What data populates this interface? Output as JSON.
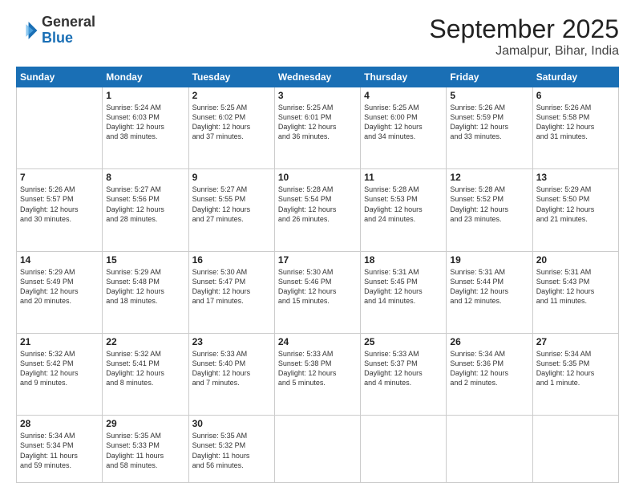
{
  "header": {
    "logo_general": "General",
    "logo_blue": "Blue",
    "month_title": "September 2025",
    "subtitle": "Jamalpur, Bihar, India"
  },
  "weekdays": [
    "Sunday",
    "Monday",
    "Tuesday",
    "Wednesday",
    "Thursday",
    "Friday",
    "Saturday"
  ],
  "weeks": [
    [
      {
        "day": "",
        "lines": []
      },
      {
        "day": "1",
        "lines": [
          "Sunrise: 5:24 AM",
          "Sunset: 6:03 PM",
          "Daylight: 12 hours",
          "and 38 minutes."
        ]
      },
      {
        "day": "2",
        "lines": [
          "Sunrise: 5:25 AM",
          "Sunset: 6:02 PM",
          "Daylight: 12 hours",
          "and 37 minutes."
        ]
      },
      {
        "day": "3",
        "lines": [
          "Sunrise: 5:25 AM",
          "Sunset: 6:01 PM",
          "Daylight: 12 hours",
          "and 36 minutes."
        ]
      },
      {
        "day": "4",
        "lines": [
          "Sunrise: 5:25 AM",
          "Sunset: 6:00 PM",
          "Daylight: 12 hours",
          "and 34 minutes."
        ]
      },
      {
        "day": "5",
        "lines": [
          "Sunrise: 5:26 AM",
          "Sunset: 5:59 PM",
          "Daylight: 12 hours",
          "and 33 minutes."
        ]
      },
      {
        "day": "6",
        "lines": [
          "Sunrise: 5:26 AM",
          "Sunset: 5:58 PM",
          "Daylight: 12 hours",
          "and 31 minutes."
        ]
      }
    ],
    [
      {
        "day": "7",
        "lines": [
          "Sunrise: 5:26 AM",
          "Sunset: 5:57 PM",
          "Daylight: 12 hours",
          "and 30 minutes."
        ]
      },
      {
        "day": "8",
        "lines": [
          "Sunrise: 5:27 AM",
          "Sunset: 5:56 PM",
          "Daylight: 12 hours",
          "and 28 minutes."
        ]
      },
      {
        "day": "9",
        "lines": [
          "Sunrise: 5:27 AM",
          "Sunset: 5:55 PM",
          "Daylight: 12 hours",
          "and 27 minutes."
        ]
      },
      {
        "day": "10",
        "lines": [
          "Sunrise: 5:28 AM",
          "Sunset: 5:54 PM",
          "Daylight: 12 hours",
          "and 26 minutes."
        ]
      },
      {
        "day": "11",
        "lines": [
          "Sunrise: 5:28 AM",
          "Sunset: 5:53 PM",
          "Daylight: 12 hours",
          "and 24 minutes."
        ]
      },
      {
        "day": "12",
        "lines": [
          "Sunrise: 5:28 AM",
          "Sunset: 5:52 PM",
          "Daylight: 12 hours",
          "and 23 minutes."
        ]
      },
      {
        "day": "13",
        "lines": [
          "Sunrise: 5:29 AM",
          "Sunset: 5:50 PM",
          "Daylight: 12 hours",
          "and 21 minutes."
        ]
      }
    ],
    [
      {
        "day": "14",
        "lines": [
          "Sunrise: 5:29 AM",
          "Sunset: 5:49 PM",
          "Daylight: 12 hours",
          "and 20 minutes."
        ]
      },
      {
        "day": "15",
        "lines": [
          "Sunrise: 5:29 AM",
          "Sunset: 5:48 PM",
          "Daylight: 12 hours",
          "and 18 minutes."
        ]
      },
      {
        "day": "16",
        "lines": [
          "Sunrise: 5:30 AM",
          "Sunset: 5:47 PM",
          "Daylight: 12 hours",
          "and 17 minutes."
        ]
      },
      {
        "day": "17",
        "lines": [
          "Sunrise: 5:30 AM",
          "Sunset: 5:46 PM",
          "Daylight: 12 hours",
          "and 15 minutes."
        ]
      },
      {
        "day": "18",
        "lines": [
          "Sunrise: 5:31 AM",
          "Sunset: 5:45 PM",
          "Daylight: 12 hours",
          "and 14 minutes."
        ]
      },
      {
        "day": "19",
        "lines": [
          "Sunrise: 5:31 AM",
          "Sunset: 5:44 PM",
          "Daylight: 12 hours",
          "and 12 minutes."
        ]
      },
      {
        "day": "20",
        "lines": [
          "Sunrise: 5:31 AM",
          "Sunset: 5:43 PM",
          "Daylight: 12 hours",
          "and 11 minutes."
        ]
      }
    ],
    [
      {
        "day": "21",
        "lines": [
          "Sunrise: 5:32 AM",
          "Sunset: 5:42 PM",
          "Daylight: 12 hours",
          "and 9 minutes."
        ]
      },
      {
        "day": "22",
        "lines": [
          "Sunrise: 5:32 AM",
          "Sunset: 5:41 PM",
          "Daylight: 12 hours",
          "and 8 minutes."
        ]
      },
      {
        "day": "23",
        "lines": [
          "Sunrise: 5:33 AM",
          "Sunset: 5:40 PM",
          "Daylight: 12 hours",
          "and 7 minutes."
        ]
      },
      {
        "day": "24",
        "lines": [
          "Sunrise: 5:33 AM",
          "Sunset: 5:38 PM",
          "Daylight: 12 hours",
          "and 5 minutes."
        ]
      },
      {
        "day": "25",
        "lines": [
          "Sunrise: 5:33 AM",
          "Sunset: 5:37 PM",
          "Daylight: 12 hours",
          "and 4 minutes."
        ]
      },
      {
        "day": "26",
        "lines": [
          "Sunrise: 5:34 AM",
          "Sunset: 5:36 PM",
          "Daylight: 12 hours",
          "and 2 minutes."
        ]
      },
      {
        "day": "27",
        "lines": [
          "Sunrise: 5:34 AM",
          "Sunset: 5:35 PM",
          "Daylight: 12 hours",
          "and 1 minute."
        ]
      }
    ],
    [
      {
        "day": "28",
        "lines": [
          "Sunrise: 5:34 AM",
          "Sunset: 5:34 PM",
          "Daylight: 11 hours",
          "and 59 minutes."
        ]
      },
      {
        "day": "29",
        "lines": [
          "Sunrise: 5:35 AM",
          "Sunset: 5:33 PM",
          "Daylight: 11 hours",
          "and 58 minutes."
        ]
      },
      {
        "day": "30",
        "lines": [
          "Sunrise: 5:35 AM",
          "Sunset: 5:32 PM",
          "Daylight: 11 hours",
          "and 56 minutes."
        ]
      },
      {
        "day": "",
        "lines": []
      },
      {
        "day": "",
        "lines": []
      },
      {
        "day": "",
        "lines": []
      },
      {
        "day": "",
        "lines": []
      }
    ]
  ]
}
